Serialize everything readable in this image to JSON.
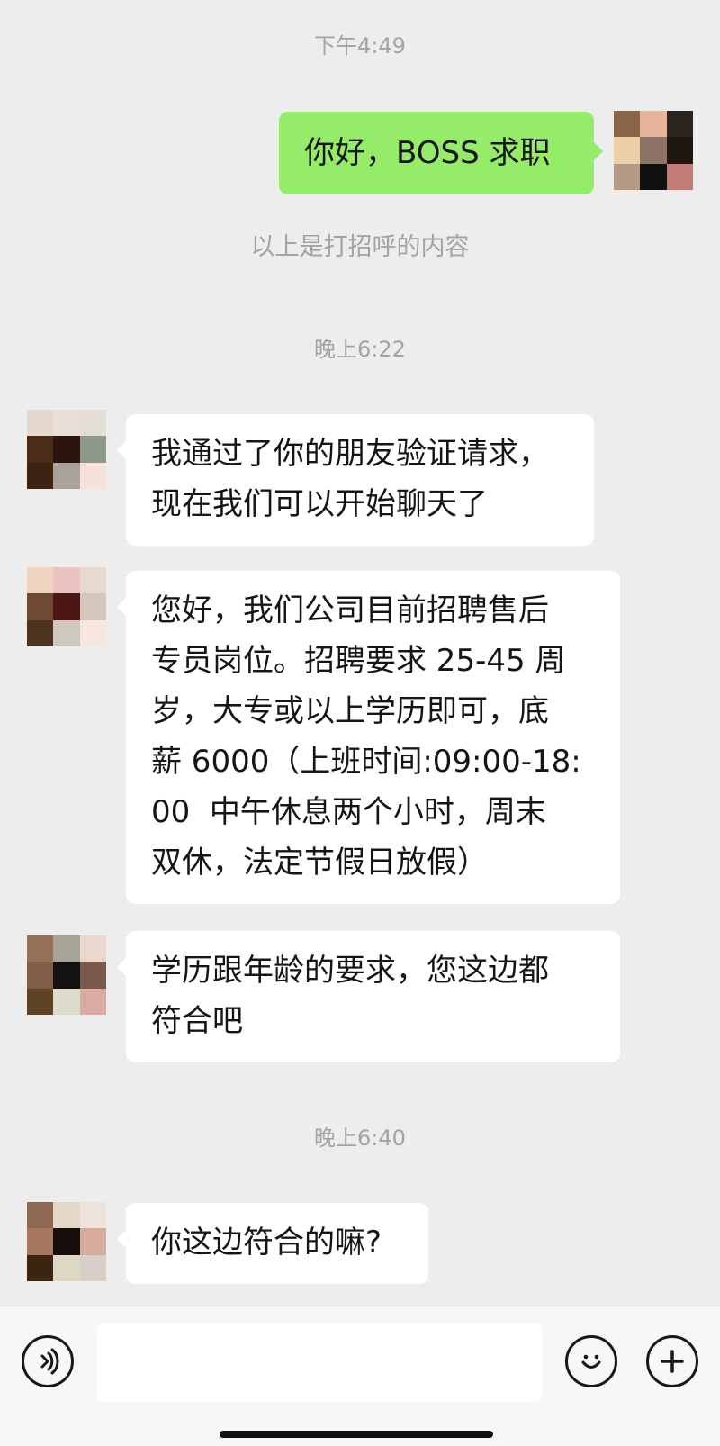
{
  "chat": {
    "time1": "下午4:49",
    "message_sent": "你好，BOSS 求职",
    "system_note": "以上是打招呼的内容",
    "time2": "晚上6:22",
    "message_1": "我通过了你的朋友验证请求，\n现在我们可以开始聊天了",
    "message_2": "您好，我们公司目前招聘售后\n专员岗位。招聘要求 25-45 周\n岁，大专或以上学历即可，底\n薪 6000（上班时间:09:00-18:\n00  中午休息两个小时，周末\n双休，法定节假日放假）",
    "message_3": "学历跟年龄的要求，您这边都\n符合吧",
    "time3": "晚上6:40",
    "message_4": "你这边符合的嘛?"
  },
  "avatars": {
    "self": [
      "#8a6548",
      "#e6b59b",
      "#2b231d",
      "#ebcfa8",
      "#8e7467",
      "#1e170f",
      "#b49a85",
      "#111010",
      "#c27b76"
    ],
    "contact": [
      "#e5d8cf",
      "#e9dfd7",
      "#e3ded6",
      "#4a2c18",
      "#2c150f",
      "#8f998b",
      "#3d2412",
      "#a8a29b",
      "#f7e2db"
    ],
    "contact_2": [
      "#f1d5c3",
      "#ebc4c1",
      "#e6d9ce",
      "#6e4a33",
      "#4b1613",
      "#d2c6bd",
      "#4c3320",
      "#cec8bd",
      "#f7e6de"
    ],
    "contact_3": [
      "#956f56",
      "#a5a497",
      "#ead8cf",
      "#805d47",
      "#141111",
      "#7a5a4b",
      "#5e4226",
      "#dddccc",
      "#ddaaa3"
    ],
    "contact_4": [
      "#8e6851",
      "#e3d8c8",
      "#eee3da",
      "#a77760",
      "#170e0b",
      "#d6aa9d",
      "#3a2610",
      "#dcd8c4",
      "#d6d0c8"
    ]
  },
  "input_bar": {
    "voice_icon": "voice-icon",
    "emoji_icon": "emoji-icon",
    "add_icon": "plus-icon",
    "input_value": ""
  }
}
